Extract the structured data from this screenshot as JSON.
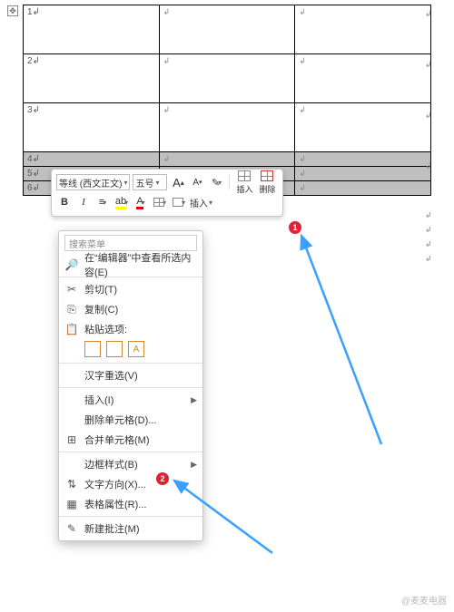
{
  "table": {
    "rows": [
      {
        "n": "1",
        "tall": true,
        "sel": false
      },
      {
        "n": "2",
        "tall": true,
        "sel": false
      },
      {
        "n": "3",
        "tall": true,
        "sel": false
      },
      {
        "n": "4",
        "tall": false,
        "sel": true
      },
      {
        "n": "5",
        "tall": false,
        "sel": true
      },
      {
        "n": "6",
        "tall": false,
        "sel": true
      }
    ]
  },
  "miniToolbar": {
    "font": "等线 (西文正文)",
    "size": "五号",
    "bigA": "A",
    "smallA": "A",
    "brush": "✎",
    "insert": "插入",
    "delete": "删除",
    "bold": "B",
    "italic": "I"
  },
  "ctx": {
    "searchPlaceholder": "搜索菜单",
    "items": [
      {
        "icon": "🔎",
        "label": "在“编辑器”中查看所选内容(E)",
        "type": "plain"
      },
      {
        "type": "sep"
      },
      {
        "icon": "✂",
        "label": "剪切(T)",
        "type": "plain"
      },
      {
        "icon": "⎘",
        "label": "复制(C)",
        "type": "plain"
      },
      {
        "icon": "📋",
        "label": "粘贴选项:",
        "type": "header"
      },
      {
        "type": "pasteicons"
      },
      {
        "type": "sep"
      },
      {
        "icon": "",
        "label": "汉字重选(V)",
        "type": "plain"
      },
      {
        "type": "sep"
      },
      {
        "icon": "",
        "label": "插入(I)",
        "type": "sub"
      },
      {
        "icon": "",
        "label": "删除单元格(D)...",
        "type": "plain"
      },
      {
        "icon": "⊞",
        "label": "合并单元格(M)",
        "type": "plain"
      },
      {
        "type": "sep"
      },
      {
        "icon": "",
        "label": "边框样式(B)",
        "type": "sub"
      },
      {
        "icon": "⇅",
        "label": "文字方向(X)...",
        "type": "plain"
      },
      {
        "icon": "▦",
        "label": "表格属性(R)...",
        "type": "plain",
        "key": "tableprops"
      },
      {
        "type": "sep"
      },
      {
        "icon": "✎",
        "label": "新建批注(M)",
        "type": "plain"
      }
    ]
  },
  "callouts": {
    "one": "1",
    "two": "2"
  },
  "watermark": "@麦麦电器"
}
